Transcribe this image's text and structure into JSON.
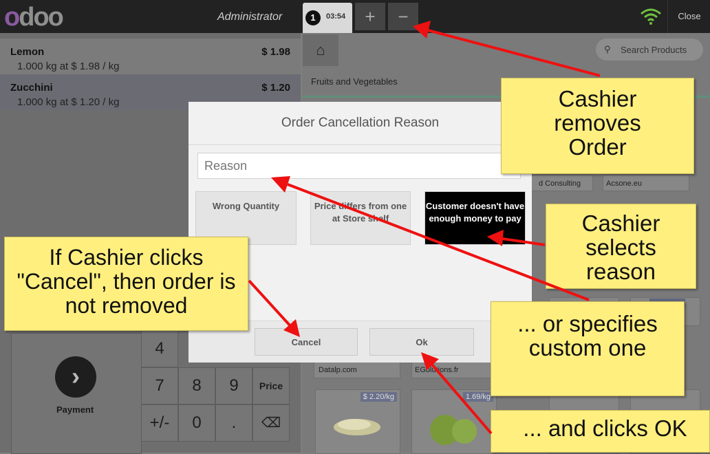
{
  "topbar": {
    "logo": "odoo",
    "user": "Administrator",
    "order_number": "1",
    "order_time": "03:54",
    "plus_label": "+",
    "minus_label": "−",
    "close_label": "Close"
  },
  "order_lines": [
    {
      "name": "Lemon",
      "detail": "1.000 kg at $ 1.98 / kg",
      "price": "$ 1.98"
    },
    {
      "name": "Zucchini",
      "detail": "1.000 kg at $ 1.20 / kg",
      "price": "$ 1.20"
    }
  ],
  "numpad": {
    "payment_label": "Payment",
    "keys": {
      "k4": "4",
      "k7": "7",
      "k8": "8",
      "k9": "9",
      "price": "Price",
      "plusminus": "+/-",
      "k0": "0",
      "dot": ".",
      "backspace": "⌫"
    }
  },
  "products": {
    "search_placeholder": "Search Products",
    "category": "Fruits and Vegetables",
    "tiles": [
      {
        "label": "d Consulting"
      },
      {
        "label": "Acsone.eu"
      },
      {
        "label": "Datalp.com"
      },
      {
        "label": "EGolutions.fr"
      },
      {
        "price": "$ 2.20/kg"
      },
      {
        "price": "1.69/kg"
      }
    ]
  },
  "modal": {
    "title": "Order Cancellation Reason",
    "reason_placeholder": "Reason",
    "reasons": [
      "Wrong Quantity",
      "Price differs from one at Store shelf",
      "Customer doesn't have enough money to pay"
    ],
    "cancel_label": "Cancel",
    "ok_label": "Ok"
  },
  "callouts": {
    "removes": "Cashier removes Order",
    "selects": "Cashier selects reason",
    "cancel_note": "If Cashier clicks \"Cancel\", then order is not removed",
    "custom": "... or specifies custom one",
    "ok_note": "... and clicks OK"
  },
  "colors": {
    "arrow": "#ee1111",
    "callout": "#ffef7f",
    "selected_reason": "#000000",
    "brand": "#8a5aa0"
  }
}
